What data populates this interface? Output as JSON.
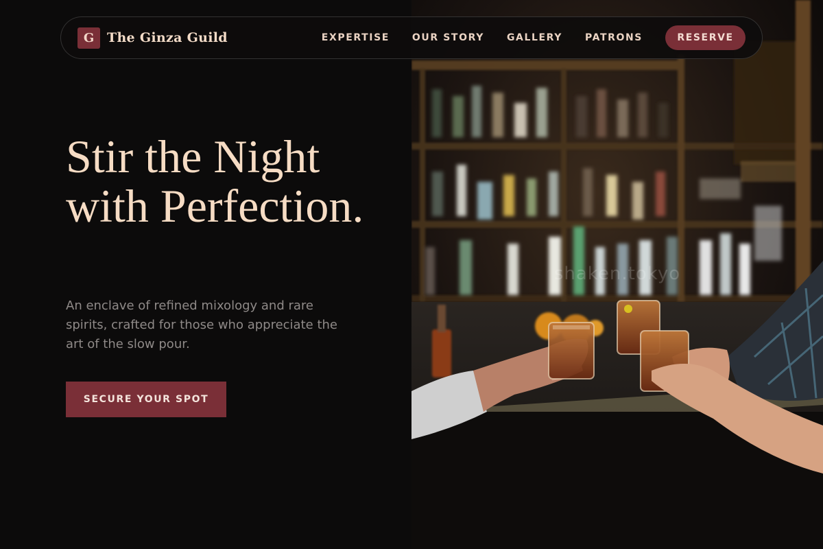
{
  "brand": {
    "mark_letter": "G",
    "name": "The Ginza Guild"
  },
  "nav": {
    "links": [
      "EXPERTISE",
      "OUR STORY",
      "GALLERY",
      "PATRONS"
    ],
    "reserve_label": "RESERVE"
  },
  "hero": {
    "title": "Stir the Night with Perfection.",
    "subtitle": "An enclave of refined mixology and rare spirits, crafted for those who appreciate the art of the slow pour.",
    "cta_label": "SECURE YOUR SPOT"
  },
  "photo": {
    "watermark": "shaken.tokyo"
  },
  "colors": {
    "background": "#0c0b0b",
    "accent": "#7a2f37",
    "title": "#f6dcc4",
    "muted_text": "#8f8a88"
  }
}
